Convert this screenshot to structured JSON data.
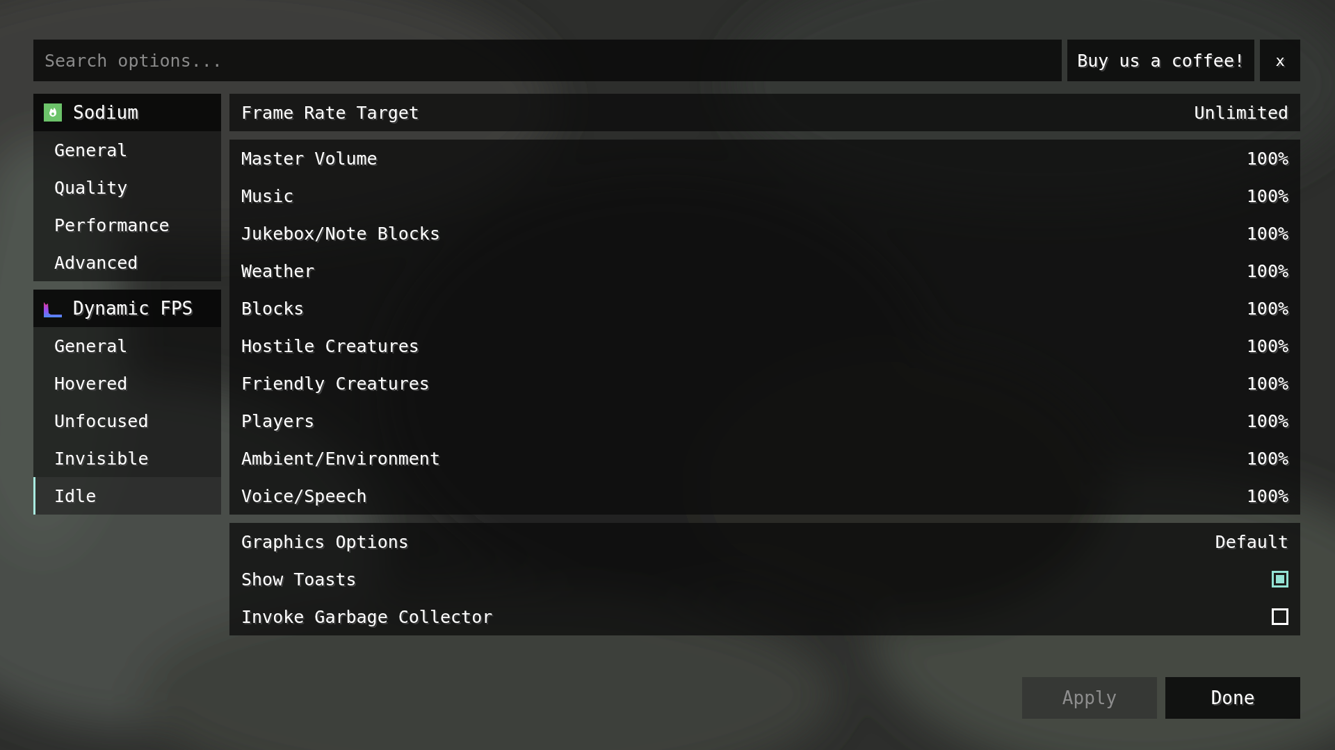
{
  "search": {
    "placeholder": "Search options..."
  },
  "header_buttons": [
    {
      "label": "Buy us a coffee!"
    },
    {
      "label": "x"
    }
  ],
  "sidebar": {
    "groups": [
      {
        "title": "Sodium",
        "items": [
          {
            "label": "General",
            "selected": false
          },
          {
            "label": "Quality",
            "selected": false
          },
          {
            "label": "Performance",
            "selected": false
          },
          {
            "label": "Advanced",
            "selected": false
          }
        ]
      },
      {
        "title": "Dynamic FPS",
        "items": [
          {
            "label": "General",
            "selected": false
          },
          {
            "label": "Hovered",
            "selected": false
          },
          {
            "label": "Unfocused",
            "selected": false
          },
          {
            "label": "Invisible",
            "selected": false
          },
          {
            "label": "Idle",
            "selected": true
          }
        ]
      }
    ]
  },
  "option_groups": [
    {
      "rows": [
        {
          "kind": "value",
          "label": "Frame Rate Target",
          "value": "Unlimited"
        }
      ]
    },
    {
      "rows": [
        {
          "kind": "value",
          "label": "Master Volume",
          "value": "100%"
        },
        {
          "kind": "value",
          "label": "Music",
          "value": "100%"
        },
        {
          "kind": "value",
          "label": "Jukebox/Note Blocks",
          "value": "100%"
        },
        {
          "kind": "value",
          "label": "Weather",
          "value": "100%"
        },
        {
          "kind": "value",
          "label": "Blocks",
          "value": "100%"
        },
        {
          "kind": "value",
          "label": "Hostile Creatures",
          "value": "100%"
        },
        {
          "kind": "value",
          "label": "Friendly Creatures",
          "value": "100%"
        },
        {
          "kind": "value",
          "label": "Players",
          "value": "100%"
        },
        {
          "kind": "value",
          "label": "Ambient/Environment",
          "value": "100%"
        },
        {
          "kind": "value",
          "label": "Voice/Speech",
          "value": "100%"
        }
      ]
    },
    {
      "rows": [
        {
          "kind": "value",
          "label": "Graphics Options",
          "value": "Default"
        },
        {
          "kind": "checkbox",
          "label": "Show Toasts",
          "checked": true
        },
        {
          "kind": "checkbox",
          "label": "Invoke Garbage Collector",
          "checked": false
        }
      ]
    }
  ],
  "footer_buttons": [
    {
      "label": "Apply",
      "disabled": true
    },
    {
      "label": "Done",
      "disabled": false
    }
  ]
}
